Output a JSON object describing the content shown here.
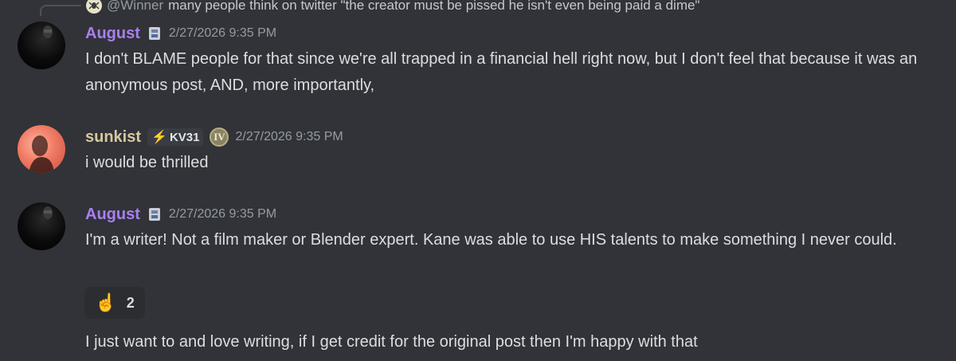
{
  "reply_preview": {
    "author": "@Winner",
    "text": "many people think on twitter \"the creator must be pissed he isn't even being paid a dime\""
  },
  "messages": [
    {
      "author": "August",
      "timestamp": "2/27/2026 9:35 PM",
      "text": "I don't BLAME people for that since we're all trapped in a financial hell right now, but I don't feel that because it was an anonymous post, AND, more importantly,"
    },
    {
      "author": "sunkist",
      "tag": "KV31",
      "level": "IV",
      "timestamp": "2/27/2026 9:35 PM",
      "text": "i would be thrilled"
    },
    {
      "author": "August",
      "timestamp": "2/27/2026 9:35 PM",
      "text": "I'm a writer! Not a film maker or Blender expert. Kane was able to use HIS talents to make something I never could.",
      "reaction": {
        "emoji": "☝",
        "count": "2"
      },
      "followup": "I just want to and love writing, if I get credit for the original post then I'm happy with that"
    }
  ],
  "colors": {
    "background": "#313338",
    "august_name": "#a97ff2",
    "sunkist_name": "#d8c7a0",
    "timestamp": "#949ba4"
  }
}
